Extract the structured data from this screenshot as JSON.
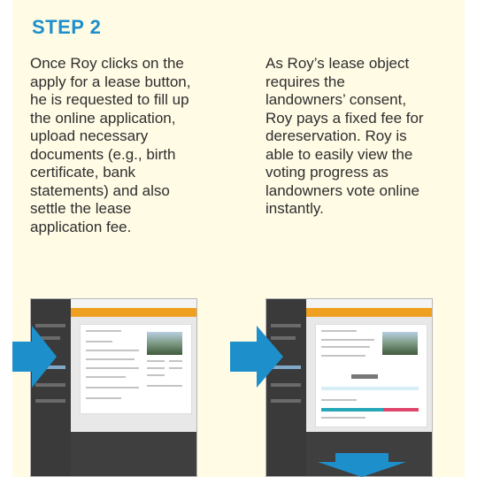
{
  "step": {
    "title": "STEP 2"
  },
  "columns": [
    {
      "text": "Once Roy clicks on the apply for a lease button, he is requested to fill up the online application, upload necessary documents (e.g., birth certificate, bank statements) and also settle the lease application fee."
    },
    {
      "text": "As Roy’s lease object requires the landowners’ consent, Roy pays a fixed fee for dereservation. Roy is able to easily view the voting progress as landowners vote online instantly."
    }
  ],
  "colors": {
    "accent": "#1d8fcb",
    "panel_bg": "#fffbe5",
    "orange_bar": "#f0a020"
  },
  "icons": [
    "arrow-right-icon",
    "arrow-down-icon"
  ]
}
